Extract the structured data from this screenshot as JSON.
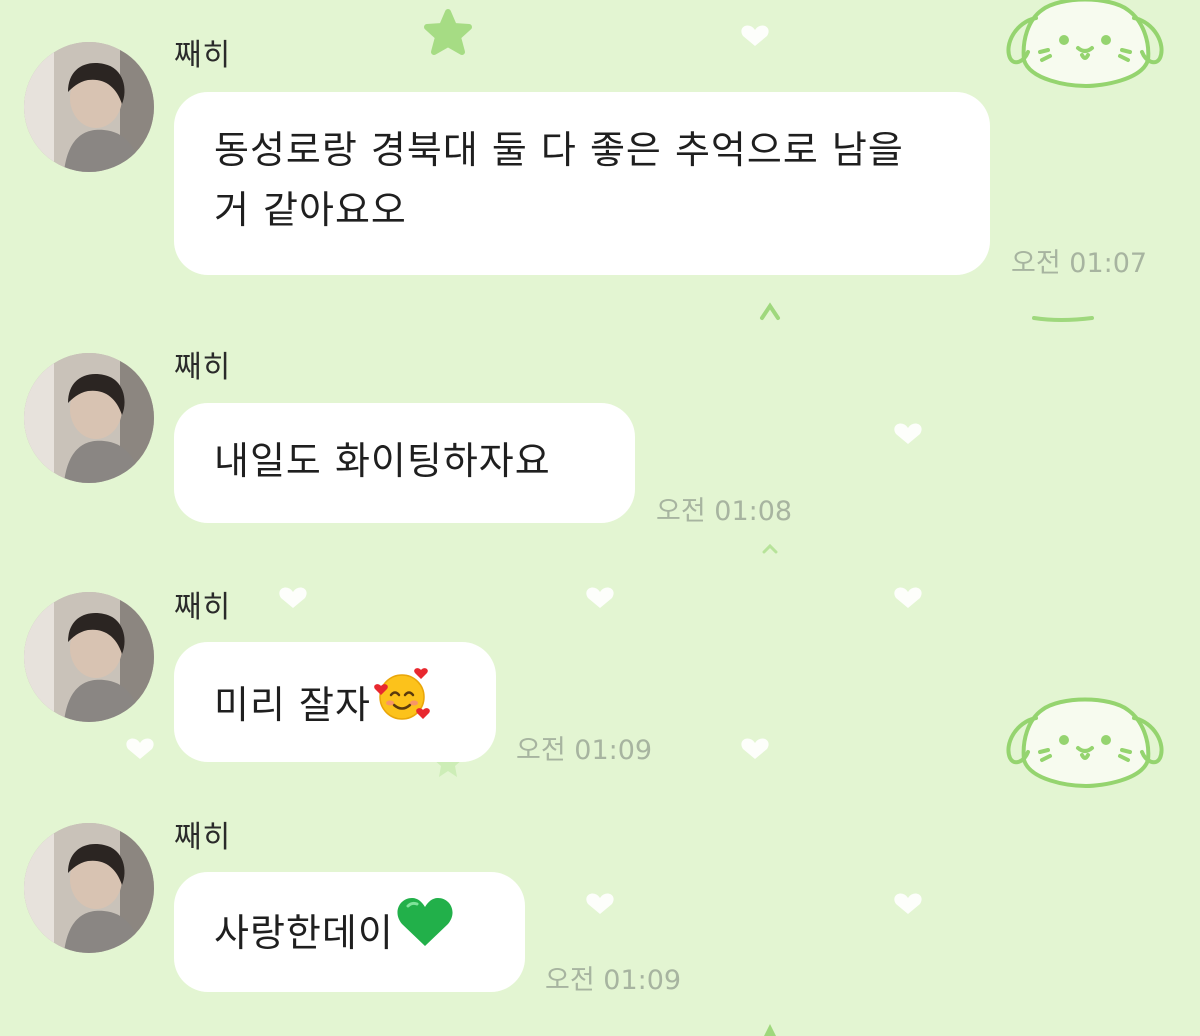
{
  "chat": {
    "messages": [
      {
        "sender": "째히",
        "text": "동성로랑 경북대 둘 다 좋은 추억으로 남을 거 같아요오",
        "time": "오전 01:07"
      },
      {
        "sender": "째히",
        "text": "내일도 화이팅하자요",
        "time": "오전 01:08"
      },
      {
        "sender": "째히",
        "text": "미리 잘자",
        "emoji": "smiling-face-with-hearts",
        "time": "오전 01:09"
      },
      {
        "sender": "째히",
        "text": "사랑한데이",
        "emoji": "green-heart",
        "time": "오전 01:09"
      }
    ]
  },
  "colors": {
    "background": "#e3f5d2",
    "bubble": "#ffffff",
    "timestamp": "#a7b4a0",
    "accent_green": "#8ed56a"
  }
}
